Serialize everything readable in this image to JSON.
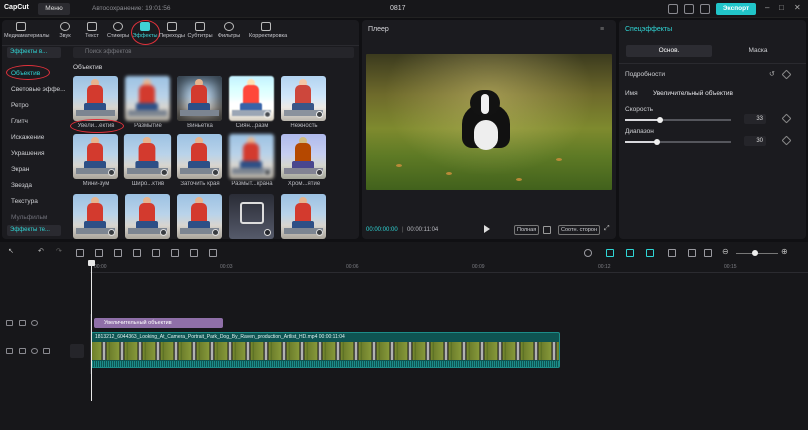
{
  "app": {
    "logo": "CapCut",
    "menu": "Меню",
    "autosave": "Автосохранение: 19:01:56",
    "title": "0817",
    "export": "Экспорт"
  },
  "toolbar": [
    {
      "label": "Медиаматериалы",
      "icon": "media-icon"
    },
    {
      "label": "Звук",
      "icon": "audio-icon"
    },
    {
      "label": "Текст",
      "icon": "text-icon"
    },
    {
      "label": "Стикеры",
      "icon": "sticker-icon"
    },
    {
      "label": "Эффекты",
      "icon": "effects-icon"
    },
    {
      "label": "Переходы",
      "icon": "transitions-icon"
    },
    {
      "label": "Субтитры",
      "icon": "subtitles-icon"
    },
    {
      "label": "Фильтры",
      "icon": "filters-icon"
    },
    {
      "label": "Корректировка",
      "icon": "adjust-icon"
    }
  ],
  "effects": {
    "dropdown": "Эффекты в...",
    "search_placeholder": "Поиск эффектов",
    "categories": [
      "Объектив",
      "Световые эффе...",
      "Ретро",
      "Глитч",
      "Искажение",
      "Украшения",
      "Экран",
      "Звезда",
      "Текстура",
      "Мульфильм"
    ],
    "bottom_dropdown": "Эффекты те...",
    "section": "Объектив",
    "items": [
      "Увели...ектив",
      "Размытие",
      "Виньетка",
      "Сиян...разм",
      "Нежность",
      "Мини-зум",
      "Широ...ктив",
      "Заточить края",
      "Размыт...крана",
      "Хром...ятие",
      "",
      "",
      "",
      "",
      ""
    ]
  },
  "player": {
    "title": "Плеер",
    "current": "00:00:00:00",
    "total": "00:00:11:04",
    "fullsize": "Полная",
    "ratio": "Соотн. сторон"
  },
  "props": {
    "title": "Спецэффекты",
    "tabs": [
      "Основ.",
      "Маска"
    ],
    "details": "Подробности",
    "name_label": "Имя",
    "name_value": "Увеличительный объектив",
    "speed_label": "Скорость",
    "speed_value": "33",
    "speed": 33,
    "range_label": "Диапазон",
    "range_value": "30",
    "range": 30
  },
  "timeline": {
    "ruler": [
      "00:00",
      "00:03",
      "00:06",
      "00:09",
      "00:12",
      "00:15"
    ],
    "effect_clip": "Увеличительный объектив",
    "video_clip": "1813212_6044363_Looking_At_Camera_Portrait_Park_Dog_By_Raven_production_Artlist_HD.mp4  00:00:11:04"
  }
}
